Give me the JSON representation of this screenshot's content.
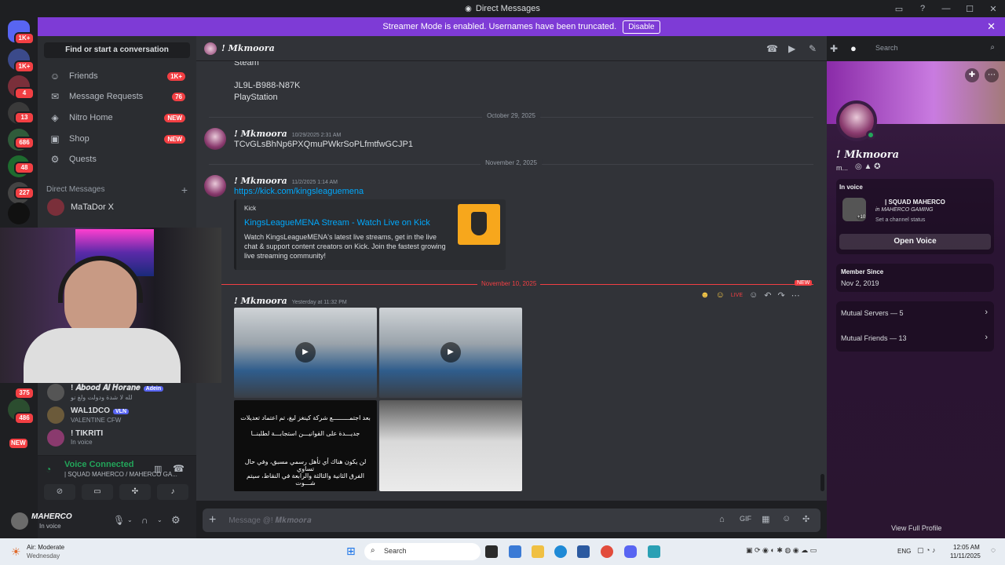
{
  "window": {
    "title": "Direct Messages"
  },
  "banner": {
    "text": "Streamer Mode is enabled. Usernames have been truncated.",
    "button": "Disable"
  },
  "rail": {
    "badges": [
      "1K+",
      "1K+",
      "4",
      "13",
      "686",
      "48",
      "227",
      "375",
      "486",
      "NEW"
    ]
  },
  "sidebar": {
    "find_placeholder": "Find or start a conversation",
    "nav": [
      {
        "label": "Friends",
        "badge": "1K+",
        "icon": "friends-icon"
      },
      {
        "label": "Message Requests",
        "badge": "76",
        "icon": "mail-icon"
      },
      {
        "label": "Nitro Home",
        "badge": "NEW",
        "icon": "nitro-icon"
      },
      {
        "label": "Shop",
        "badge": "NEW",
        "icon": "shop-icon"
      },
      {
        "label": "Quests",
        "badge": "",
        "icon": "quests-icon"
      }
    ],
    "dm_header": "Direct Messages",
    "dms": [
      {
        "name": "MaTaDor X",
        "sub": ""
      },
      {
        "name": "! 𝑨𝒃𝒐𝒐𝒅 𝑨𝒍 𝑯𝒐𝒓𝒂𝒏𝒆",
        "tag": "Adein",
        "sub": "لله لا شدة ودولت ولغ نو"
      },
      {
        "name": "WAL1DCO",
        "tag": "VLN",
        "sub": "VALENTINE CFW"
      },
      {
        "name": "! TIKRITI",
        "sub": "In voice"
      }
    ]
  },
  "voice": {
    "status": "Voice Connected",
    "channel": "| SQUAD MAHERCO / MAHERCO GA..."
  },
  "user": {
    "name": "MAHERCO",
    "status": "In voice"
  },
  "chat": {
    "header_name": "! 𝑴𝒌𝒎𝒐𝒐𝒓𝒂",
    "search_placeholder": "Search",
    "lines_top": [
      "Steam",
      "JL9L-B988-N87K",
      "PlayStation"
    ],
    "date1": "October 29, 2025",
    "msg1": {
      "author": "! 𝑴𝒌𝒎𝒐𝒐𝒓𝒂",
      "time": "10/29/2025 2:31 AM",
      "text": "TCvGLsBhNp6PXQmuPWkrSoPLfmtfwGCJP1"
    },
    "date2": "November 2, 2025",
    "msg2": {
      "author": "! 𝑴𝒌𝒎𝒐𝒐𝒓𝒂",
      "time": "11/2/2025 1:14 AM",
      "link": "https://kick.com/kingsleaguemena"
    },
    "embed": {
      "provider": "Kick",
      "title": "KingsLeagueMENA Stream - Watch Live on Kick",
      "description": "Watch KingsLeagueMENA's latest live streams, get in the live chat & support content creators on Kick. Join the fastest growing live streaming community!"
    },
    "date3": "November 10, 2025",
    "new_label": "NEW",
    "msg3": {
      "author": "! 𝑴𝒌𝒎𝒐𝒐𝒓𝒂",
      "time": "Yesterday at 11:32 PM"
    },
    "arabic1": "بعد اجتمـــــــــع شركة كينغز ليغ، تم اعتماد تعديلات",
    "arabic2": "جديـــدة على القوانيـــن استجابـــة لطلبنــا",
    "arabic3": "لن يكون هناك أي تأهل رسمي مسبق، وفي حال تساوي",
    "arabic4": "الفرق الثانية والثالثة والرابعة في النقاط، سيتم شـــوت",
    "composer_placeholder": "Message @! 𝑴𝒌𝒎𝒐𝒐𝒓𝒂"
  },
  "profile": {
    "name": "! 𝑴𝒌𝒎𝒐𝒐𝒓𝒂",
    "sub": "m...",
    "in_voice_label": "In voice",
    "voice_channel": "| SQUAD MAHERCO",
    "voice_server": "in MAHERCO GAMING",
    "channel_status": "Set a channel status",
    "extra_count": "+10",
    "open_voice": "Open Voice",
    "member_since_label": "Member Since",
    "member_since": "Nov 2, 2019",
    "mutual_servers": "Mutual Servers — 5",
    "mutual_friends": "Mutual Friends — 13",
    "view_full": "View Full Profile"
  },
  "taskbar": {
    "weather": "Air: Moderate",
    "weather_sub": "Wednesday",
    "search": "Search",
    "lang": "ENG",
    "time": "12:05 AM",
    "date": "11/11/2025"
  },
  "colors": {
    "accent": "#7e3bd6",
    "blurple": "#5865f2",
    "red": "#f23f43",
    "green": "#23a55a",
    "link": "#00a8fc"
  }
}
